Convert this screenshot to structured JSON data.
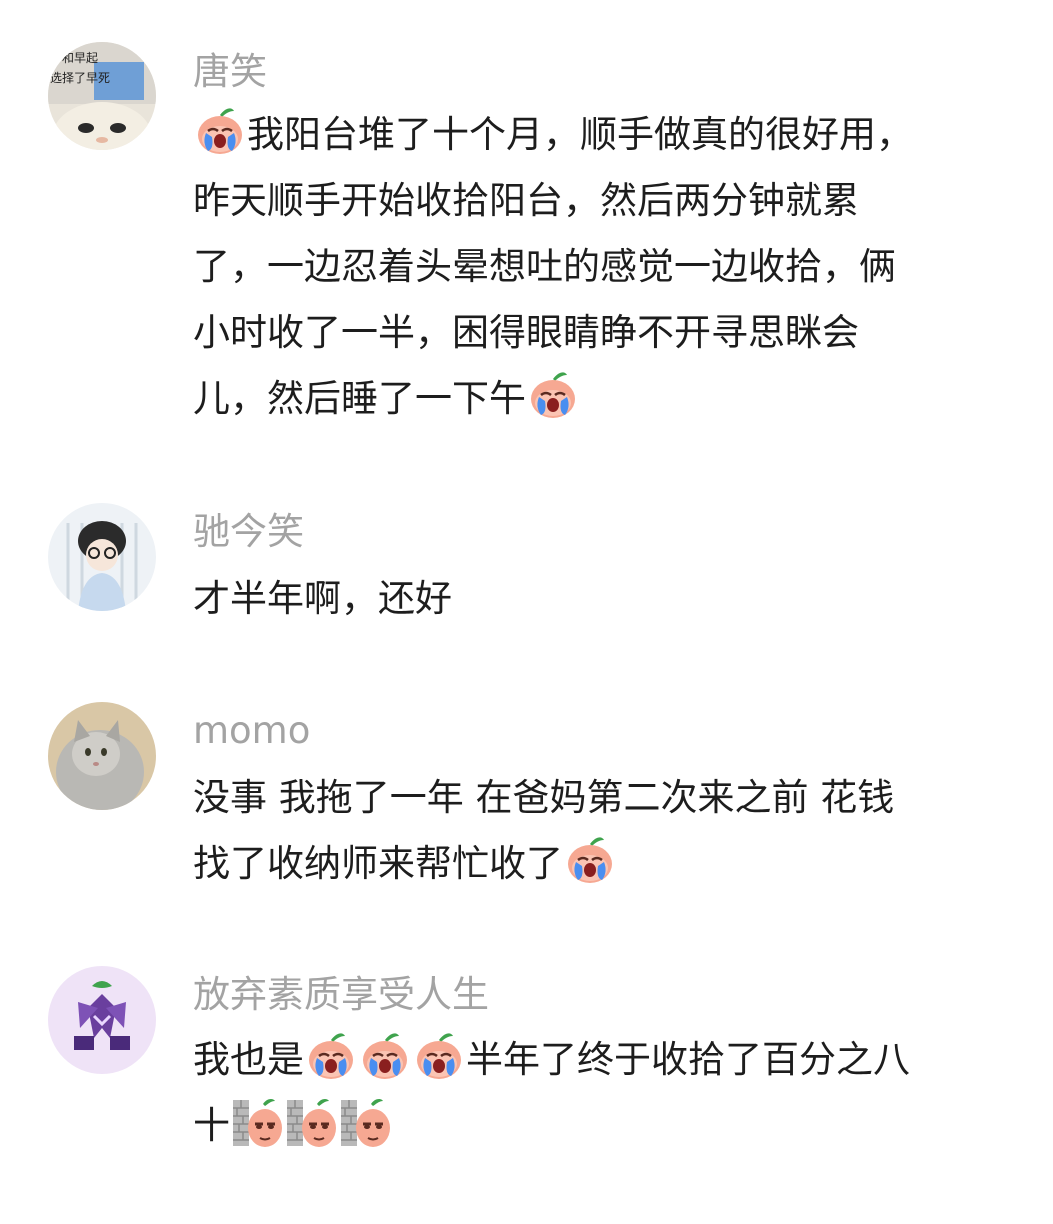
{
  "comments": [
    {
      "username": "唐笑",
      "avatar_text": [
        "和早起",
        "选择了早死"
      ],
      "lines": {
        "l1": "我阳台堆了十个月，顺手做真的很好用，",
        "l2": "昨天顺手开始收拾阳台，然后两分钟就累",
        "l3": "了，一边忍着头晕想吐的感觉一边收拾，俩",
        "l4": "小时收了一半，困得眼睛睁不开寻思眯会",
        "l5": "儿，然后睡了一下午"
      }
    },
    {
      "username": "驰今笑",
      "lines": {
        "l1": "才半年啊，还好"
      }
    },
    {
      "username": "momo",
      "lines": {
        "l1": "没事 我拖了一年 在爸妈第二次来之前 花钱",
        "l2": "找了收纳师来帮忙收了"
      }
    },
    {
      "username": "放弃素质享受人生",
      "lines": {
        "l1a": "我也是",
        "l1b": "半年了终于收拾了百分之八",
        "l2": "十"
      }
    }
  ],
  "icons": {
    "crying-emoji": "crying-peach-face",
    "wall-peek-emoji": "peeking-behind-wall-face"
  },
  "colors": {
    "username": "#a3a3a3",
    "text": "#1d1d1d",
    "emoji_face": "#f4a48f",
    "tears": "#4a8ef0"
  }
}
